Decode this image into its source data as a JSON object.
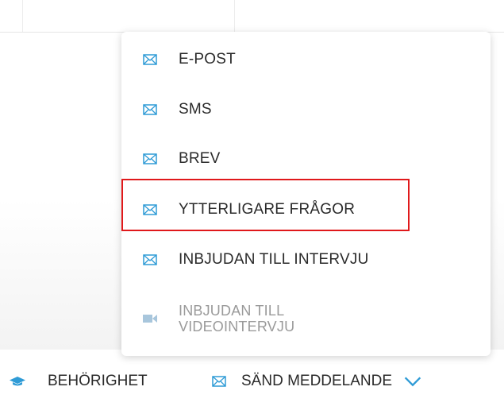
{
  "menu": {
    "items": [
      {
        "label": "E-POST",
        "icon": "envelope-icon",
        "enabled": true
      },
      {
        "label": "SMS",
        "icon": "envelope-icon",
        "enabled": true
      },
      {
        "label": "BREV",
        "icon": "envelope-icon",
        "enabled": true
      },
      {
        "label": "YTTERLIGARE FRÅGOR",
        "icon": "envelope-icon",
        "enabled": true,
        "highlighted": true
      },
      {
        "label": "INBJUDAN TILL INTERVJU",
        "icon": "envelope-icon",
        "enabled": true
      },
      {
        "label_line1": "INBJUDAN TILL",
        "label_line2": "VIDEOINTERVJU",
        "icon": "video-camera-icon",
        "enabled": false
      }
    ]
  },
  "toolbar": {
    "permission_label": "BEHÖRIGHET",
    "permission_icon": "graduation-cap-icon",
    "send_message_label": "SÄND MEDDELANDE",
    "send_message_icon": "envelope-icon",
    "dropdown_icon": "chevron-down-icon"
  },
  "colors": {
    "accent": "#2f9bd6",
    "highlight_border": "#e0191b",
    "disabled": "#9a9a9a"
  }
}
